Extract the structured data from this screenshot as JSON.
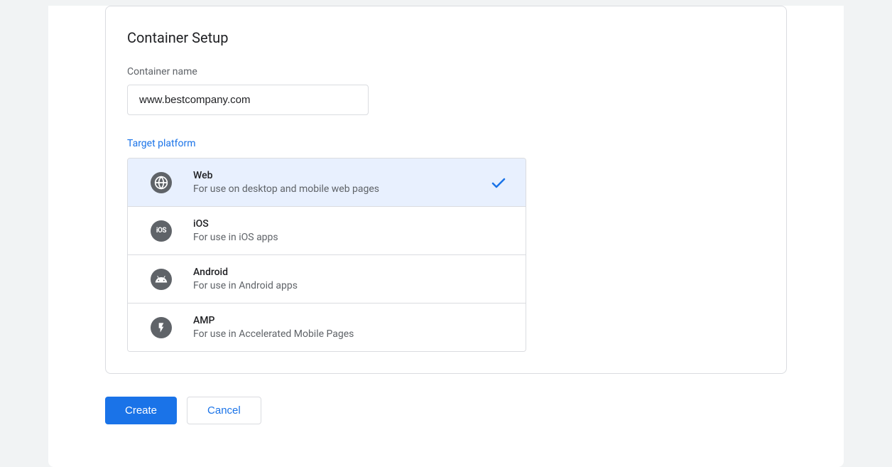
{
  "card": {
    "title": "Container Setup",
    "nameLabel": "Container name",
    "nameValue": "www.bestcompany.com",
    "platformLabel": "Target platform"
  },
  "platforms": [
    {
      "title": "Web",
      "desc": "For use on desktop and mobile web pages",
      "selected": true
    },
    {
      "title": "iOS",
      "desc": "For use in iOS apps",
      "selected": false
    },
    {
      "title": "Android",
      "desc": "For use in Android apps",
      "selected": false
    },
    {
      "title": "AMP",
      "desc": "For use in Accelerated Mobile Pages",
      "selected": false
    }
  ],
  "buttons": {
    "create": "Create",
    "cancel": "Cancel"
  }
}
